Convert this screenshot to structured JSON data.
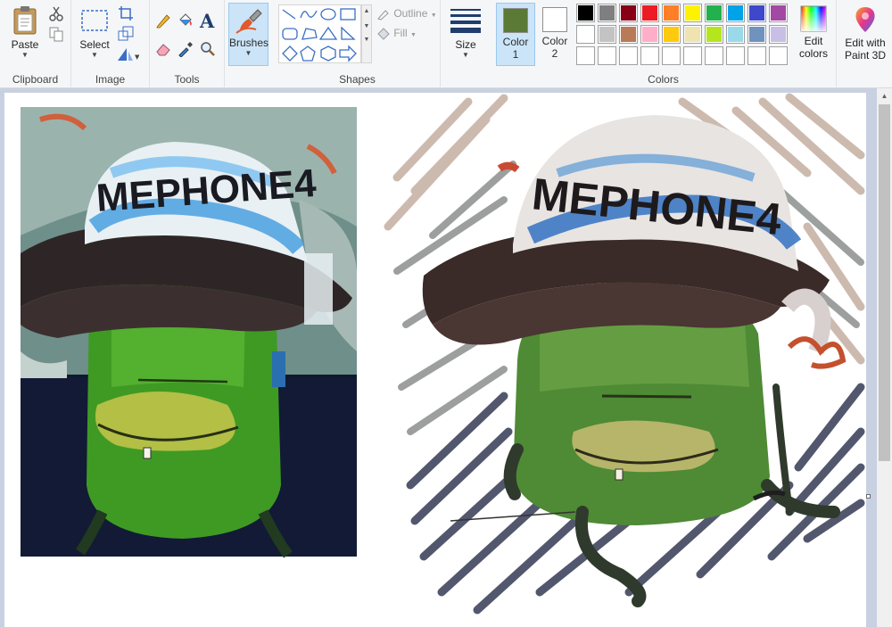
{
  "ribbon": {
    "clipboard": {
      "paste_label": "Paste",
      "group_label": "Clipboard"
    },
    "image": {
      "select_label": "Select",
      "group_label": "Image"
    },
    "tools": {
      "group_label": "Tools",
      "text_glyph": "A"
    },
    "brushes": {
      "label": "Brushes"
    },
    "shapes": {
      "group_label": "Shapes",
      "outline_label": "Outline",
      "fill_label": "Fill"
    },
    "size": {
      "label": "Size"
    },
    "colors": {
      "group_label": "Colors",
      "color1_label": "Color",
      "color1_num": "1",
      "color2_label": "Color",
      "color2_num": "2",
      "color1_value": "#5a7a35",
      "color2_value": "#ffffff",
      "palette_row1": [
        "#000000",
        "#7f7f7f",
        "#880015",
        "#ed1c24",
        "#ff7f27",
        "#fff200",
        "#22b14c",
        "#00a2e8",
        "#3f48cc",
        "#a349a4"
      ],
      "palette_row2": [
        "#ffffff",
        "#c3c3c3",
        "#b97a57",
        "#ffaec9",
        "#ffc90e",
        "#efe4b0",
        "#b5e61d",
        "#99d9ea",
        "#7092be",
        "#c8bfe7"
      ],
      "palette_row3": [
        "#ffffff",
        "#ffffff",
        "#ffffff",
        "#ffffff",
        "#ffffff",
        "#ffffff",
        "#ffffff",
        "#ffffff",
        "#ffffff",
        "#ffffff"
      ],
      "edit_label_line1": "Edit",
      "edit_label_line2": "colors"
    },
    "paint3d": {
      "line1": "Edit with",
      "line2": "Paint 3D"
    }
  },
  "canvas": {
    "photo_hat_text": "MEPHONE4",
    "drawing_hat_text": "MEPHONE4"
  }
}
